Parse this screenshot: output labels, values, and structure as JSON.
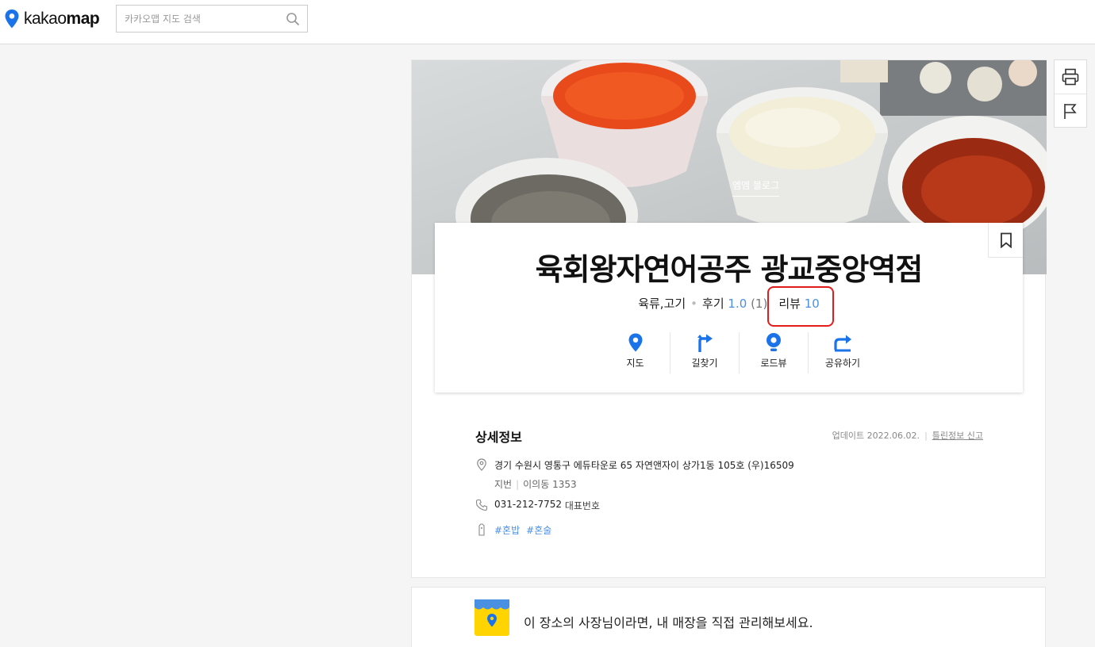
{
  "header": {
    "logo_brand": "kakao",
    "logo_bold": "map",
    "search_placeholder": "카카오맵 지도 검색"
  },
  "photo": {
    "caption": "엠엠 블로그"
  },
  "place": {
    "name": "육회왕자연어공주 광교중앙역점",
    "category": "육류,고기",
    "rating_label": "후기",
    "rating_value": "1.0",
    "rating_count": "(1)",
    "review_label": "리뷰",
    "review_count": "10"
  },
  "actions": [
    {
      "label": "지도"
    },
    {
      "label": "길찾기"
    },
    {
      "label": "로드뷰"
    },
    {
      "label": "공유하기"
    }
  ],
  "detail": {
    "title": "상세정보",
    "updated": "업데이트 2022.06.02.",
    "report": "틀린정보 신고",
    "address": "경기 수원시 영통구 에듀타운로 65 자연앤자이 상가1동 105호 (우)16509",
    "lot_label": "지번",
    "lot_address": "이의동 1353",
    "phone": "031-212-7752",
    "phone_label": "대표번호",
    "tags": [
      "#혼밥",
      "#혼술"
    ]
  },
  "owner": {
    "text": "이 장소의 사장님이라면, 내 매장을 직접 관리해보세요."
  },
  "colors": {
    "accent_blue": "#4a90e2",
    "icon_blue": "#1a73e8",
    "highlight_red": "#e31b1b",
    "owner_yellow": "#ffd400"
  }
}
